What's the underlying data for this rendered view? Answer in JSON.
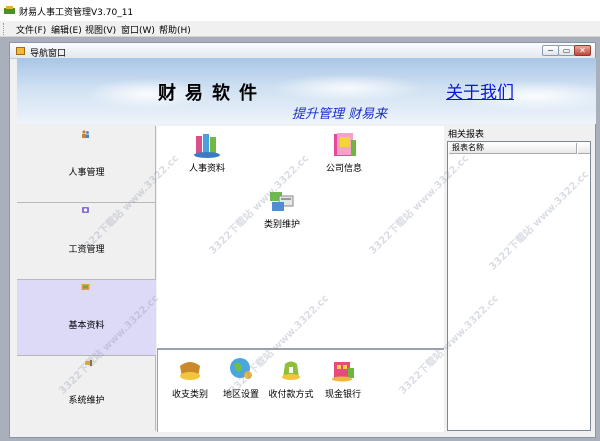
{
  "app": {
    "title": "财易人事工资管理V3.70_11"
  },
  "menu": [
    {
      "label": "文件(F)"
    },
    {
      "label": "编辑(E)"
    },
    {
      "label": "视图(V)"
    },
    {
      "label": "窗口(W)"
    },
    {
      "label": "帮助(H)"
    }
  ],
  "child_window": {
    "title": "导航窗口",
    "buttons": {
      "minimize": "−",
      "restore": "▭",
      "close": "✕"
    }
  },
  "banner": {
    "title": "财易软件",
    "slogan": "提升管理 财易来",
    "about_link": "关于我们"
  },
  "nav": [
    {
      "label": "人事管理",
      "icon": "people-icon"
    },
    {
      "label": "工资管理",
      "icon": "money-icon"
    },
    {
      "label": "基本资料",
      "icon": "folder-icon",
      "selected": true
    },
    {
      "label": "系统维护",
      "icon": "tools-icon"
    }
  ],
  "tiles": [
    {
      "label": "人事资料",
      "icon": "personnel-files-icon"
    },
    {
      "label": "公司信息",
      "icon": "company-info-icon"
    },
    {
      "label": "类别维护",
      "icon": "category-maintenance-icon"
    }
  ],
  "bottom_tiles": [
    {
      "label": "收支类别",
      "icon": "income-expense-icon"
    },
    {
      "label": "地区设置",
      "icon": "region-settings-icon"
    },
    {
      "label": "收付款方式",
      "icon": "payment-method-icon"
    },
    {
      "label": "现金银行",
      "icon": "cash-bank-icon"
    }
  ],
  "reports": {
    "title": "相关报表",
    "column": "报表名称"
  },
  "watermark": "3322下载站 www.3322.cc"
}
